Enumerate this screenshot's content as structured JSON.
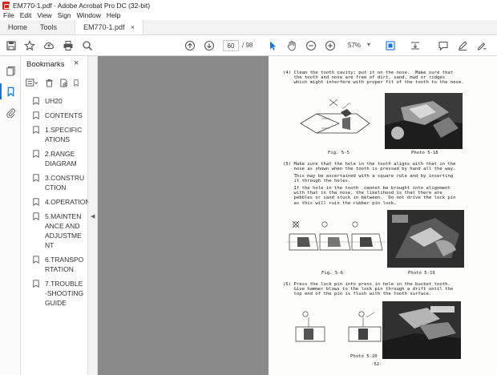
{
  "window": {
    "title": "EM770-1.pdf - Adobe Acrobat Pro DC (32-bit)"
  },
  "menu": [
    "File",
    "Edit",
    "View",
    "Sign",
    "Window",
    "Help"
  ],
  "tabs": {
    "home": "Home",
    "tools": "Tools",
    "document": "EM770-1.pdf",
    "close": "×"
  },
  "toolbar": {
    "page_current": "60",
    "page_total": "/ 98",
    "zoom": "57%"
  },
  "bookmarks": {
    "title": "Bookmarks",
    "close": "×",
    "items": [
      "UH20",
      "CONTENTS",
      "1.SPECIFICATIONS",
      "2.RANGE DIAGRAM",
      "3.CONSTRUCTION",
      "4.OPERATION",
      "5.MAINTENANCE AND ADJUSTMENT",
      "6.TRANSPORTATION",
      "7.TROUBLE-SHOOTING GUIDE"
    ]
  },
  "document": {
    "step4": "(4) Clean the tooth cavity; put it on the nose.  Make sure that\n    the tooth and nose are free of dirt, sand, mud or ridges\n    which might interfere with proper fit of the tooth to the nose.",
    "fig55": "Fig. 5-5",
    "photo518": "Photo 5-18",
    "step5a": "(5) Make sure that the hole in the tooth aligns with that in the\n    nose as shown when the tooth is pressed by hand all the way.",
    "step5b": "    This may be ascertained with a square rule and by inserting\n    it through the holes.",
    "step5c": "    If the hole in the tooth  cannot be brought into alignment\n    with that in the nose, the likelihood is that there are\n    pebbles or sand stuck in between.  Do not drive the lock pin\n    as this will ruin the rubber pin lock.",
    "fig56": "Fig. 5-6",
    "photo519": "Photo 5-19",
    "step6": "(6) Press the lock pin into press in hole in the bucket tooth.\n    Give hammer blows to the lock pin through a drift until the\n    top end of the pin is flush with the tooth surface.",
    "photo520": "Photo 5-20",
    "page_number": "-52-"
  },
  "colors": {
    "accent": "#1473e6",
    "viewer_bg": "#8a8a8a"
  }
}
